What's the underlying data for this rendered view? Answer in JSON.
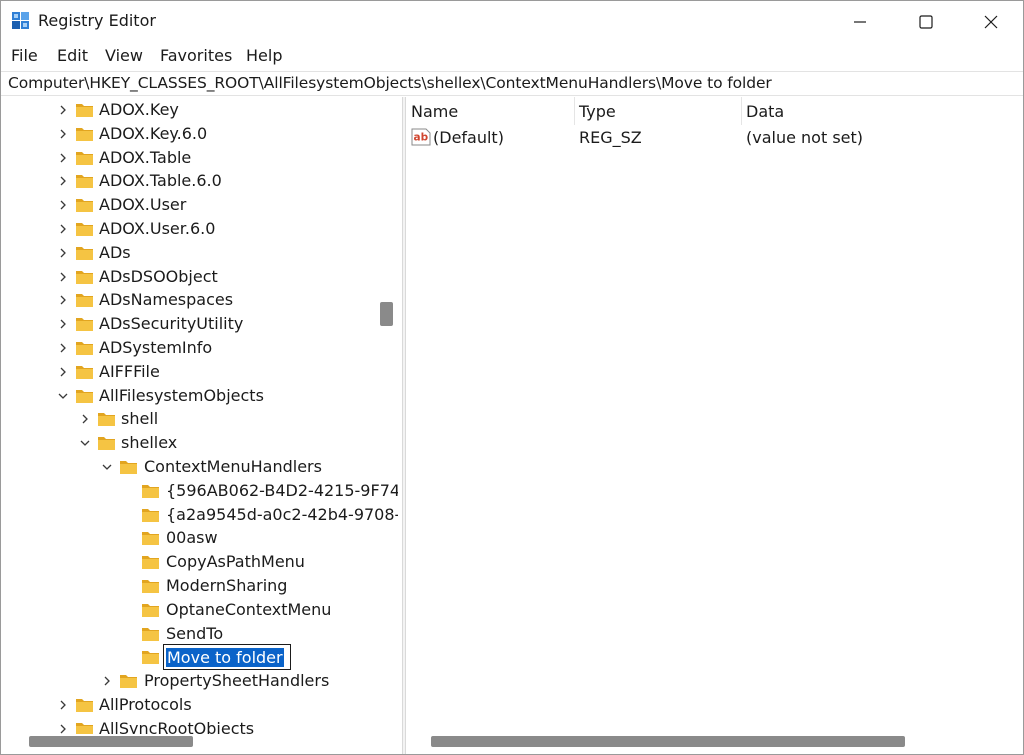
{
  "window": {
    "title": "Registry Editor"
  },
  "menu": [
    "File",
    "Edit",
    "View",
    "Favorites",
    "Help"
  ],
  "address": {
    "path": "Computer\\HKEY_CLASSES_ROOT\\AllFilesystemObjects\\shellex\\ContextMenuHandlers\\Move to folder"
  },
  "tree": {
    "items": [
      {
        "label": "ADOX.Key",
        "expanded": false
      },
      {
        "label": "ADOX.Key.6.0",
        "expanded": false
      },
      {
        "label": "ADOX.Table",
        "expanded": false
      },
      {
        "label": "ADOX.Table.6.0",
        "expanded": false
      },
      {
        "label": "ADOX.User",
        "expanded": false
      },
      {
        "label": "ADOX.User.6.0",
        "expanded": false
      },
      {
        "label": "ADs",
        "expanded": false
      },
      {
        "label": "ADsDSOObject",
        "expanded": false
      },
      {
        "label": "ADsNamespaces",
        "expanded": false
      },
      {
        "label": "ADsSecurityUtility",
        "expanded": false
      },
      {
        "label": "ADSystemInfo",
        "expanded": false
      },
      {
        "label": "AIFFFile",
        "expanded": false
      },
      {
        "label": "AllFilesystemObjects",
        "expanded": true
      },
      {
        "label": "shell",
        "expanded": false
      },
      {
        "label": "shellex",
        "expanded": true
      },
      {
        "label": "ContextMenuHandlers",
        "expanded": true
      },
      {
        "label": "{596AB062-B4D2-4215-9F74"
      },
      {
        "label": "{a2a9545d-a0c2-42b4-9708-"
      },
      {
        "label": "00asw"
      },
      {
        "label": "CopyAsPathMenu"
      },
      {
        "label": "ModernSharing"
      },
      {
        "label": "OptaneContextMenu"
      },
      {
        "label": "SendTo"
      },
      {
        "label": "Move to folder",
        "editing": true
      },
      {
        "label": "PropertySheetHandlers",
        "expanded": false
      },
      {
        "label": "AllProtocols",
        "expanded": false
      },
      {
        "label": "AllSyncRootObjects",
        "expanded": false
      }
    ]
  },
  "list": {
    "columns": [
      "Name",
      "Type",
      "Data"
    ],
    "rows": [
      {
        "icon": "string-value-icon",
        "name": "(Default)",
        "type": "REG_SZ",
        "data": "(value not set)"
      }
    ]
  },
  "colors": {
    "folder": "#f5c443",
    "selection": "#0a63c9",
    "scrollbar": "#8a8a8a"
  }
}
